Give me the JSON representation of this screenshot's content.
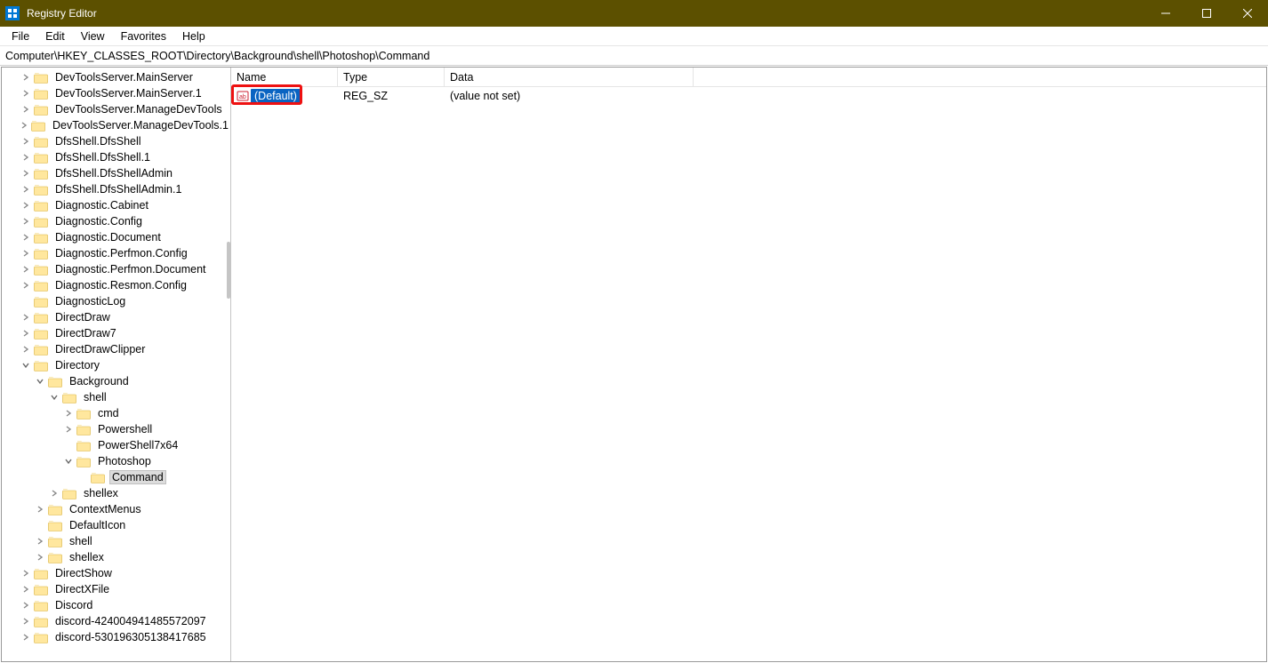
{
  "window": {
    "title": "Registry Editor"
  },
  "menu": {
    "items": [
      "File",
      "Edit",
      "View",
      "Favorites",
      "Help"
    ]
  },
  "address": {
    "path": "Computer\\HKEY_CLASSES_ROOT\\Directory\\Background\\shell\\Photoshop\\Command"
  },
  "columns": {
    "name": "Name",
    "type": "Type",
    "data": "Data"
  },
  "values": [
    {
      "name": "(Default)",
      "type": "REG_SZ",
      "data": "(value not set)",
      "selected": true
    }
  ],
  "tree": [
    {
      "depth": 1,
      "exp": "closed",
      "label": "DevToolsServer.MainServer"
    },
    {
      "depth": 1,
      "exp": "closed",
      "label": "DevToolsServer.MainServer.1"
    },
    {
      "depth": 1,
      "exp": "closed",
      "label": "DevToolsServer.ManageDevTools"
    },
    {
      "depth": 1,
      "exp": "closed",
      "label": "DevToolsServer.ManageDevTools.1"
    },
    {
      "depth": 1,
      "exp": "closed",
      "label": "DfsShell.DfsShell"
    },
    {
      "depth": 1,
      "exp": "closed",
      "label": "DfsShell.DfsShell.1"
    },
    {
      "depth": 1,
      "exp": "closed",
      "label": "DfsShell.DfsShellAdmin"
    },
    {
      "depth": 1,
      "exp": "closed",
      "label": "DfsShell.DfsShellAdmin.1"
    },
    {
      "depth": 1,
      "exp": "closed",
      "label": "Diagnostic.Cabinet"
    },
    {
      "depth": 1,
      "exp": "closed",
      "label": "Diagnostic.Config"
    },
    {
      "depth": 1,
      "exp": "closed",
      "label": "Diagnostic.Document"
    },
    {
      "depth": 1,
      "exp": "closed",
      "label": "Diagnostic.Perfmon.Config"
    },
    {
      "depth": 1,
      "exp": "closed",
      "label": "Diagnostic.Perfmon.Document"
    },
    {
      "depth": 1,
      "exp": "closed",
      "label": "Diagnostic.Resmon.Config"
    },
    {
      "depth": 1,
      "exp": "leaf",
      "label": "DiagnosticLog"
    },
    {
      "depth": 1,
      "exp": "closed",
      "label": "DirectDraw"
    },
    {
      "depth": 1,
      "exp": "closed",
      "label": "DirectDraw7"
    },
    {
      "depth": 1,
      "exp": "closed",
      "label": "DirectDrawClipper"
    },
    {
      "depth": 1,
      "exp": "open",
      "label": "Directory"
    },
    {
      "depth": 2,
      "exp": "open",
      "label": "Background"
    },
    {
      "depth": 3,
      "exp": "open",
      "label": "shell"
    },
    {
      "depth": 4,
      "exp": "closed",
      "label": "cmd"
    },
    {
      "depth": 4,
      "exp": "closed",
      "label": "Powershell"
    },
    {
      "depth": 4,
      "exp": "leaf",
      "label": "PowerShell7x64"
    },
    {
      "depth": 4,
      "exp": "open",
      "label": "Photoshop"
    },
    {
      "depth": 5,
      "exp": "leaf",
      "label": "Command",
      "selected": true
    },
    {
      "depth": 3,
      "exp": "closed",
      "label": "shellex"
    },
    {
      "depth": 2,
      "exp": "closed",
      "label": "ContextMenus"
    },
    {
      "depth": 2,
      "exp": "leaf",
      "label": "DefaultIcon"
    },
    {
      "depth": 2,
      "exp": "closed",
      "label": "shell"
    },
    {
      "depth": 2,
      "exp": "closed",
      "label": "shellex"
    },
    {
      "depth": 1,
      "exp": "closed",
      "label": "DirectShow"
    },
    {
      "depth": 1,
      "exp": "closed",
      "label": "DirectXFile"
    },
    {
      "depth": 1,
      "exp": "closed",
      "label": "Discord"
    },
    {
      "depth": 1,
      "exp": "closed",
      "label": "discord-424004941485572097"
    },
    {
      "depth": 1,
      "exp": "closed",
      "label": "discord-530196305138417685"
    }
  ]
}
